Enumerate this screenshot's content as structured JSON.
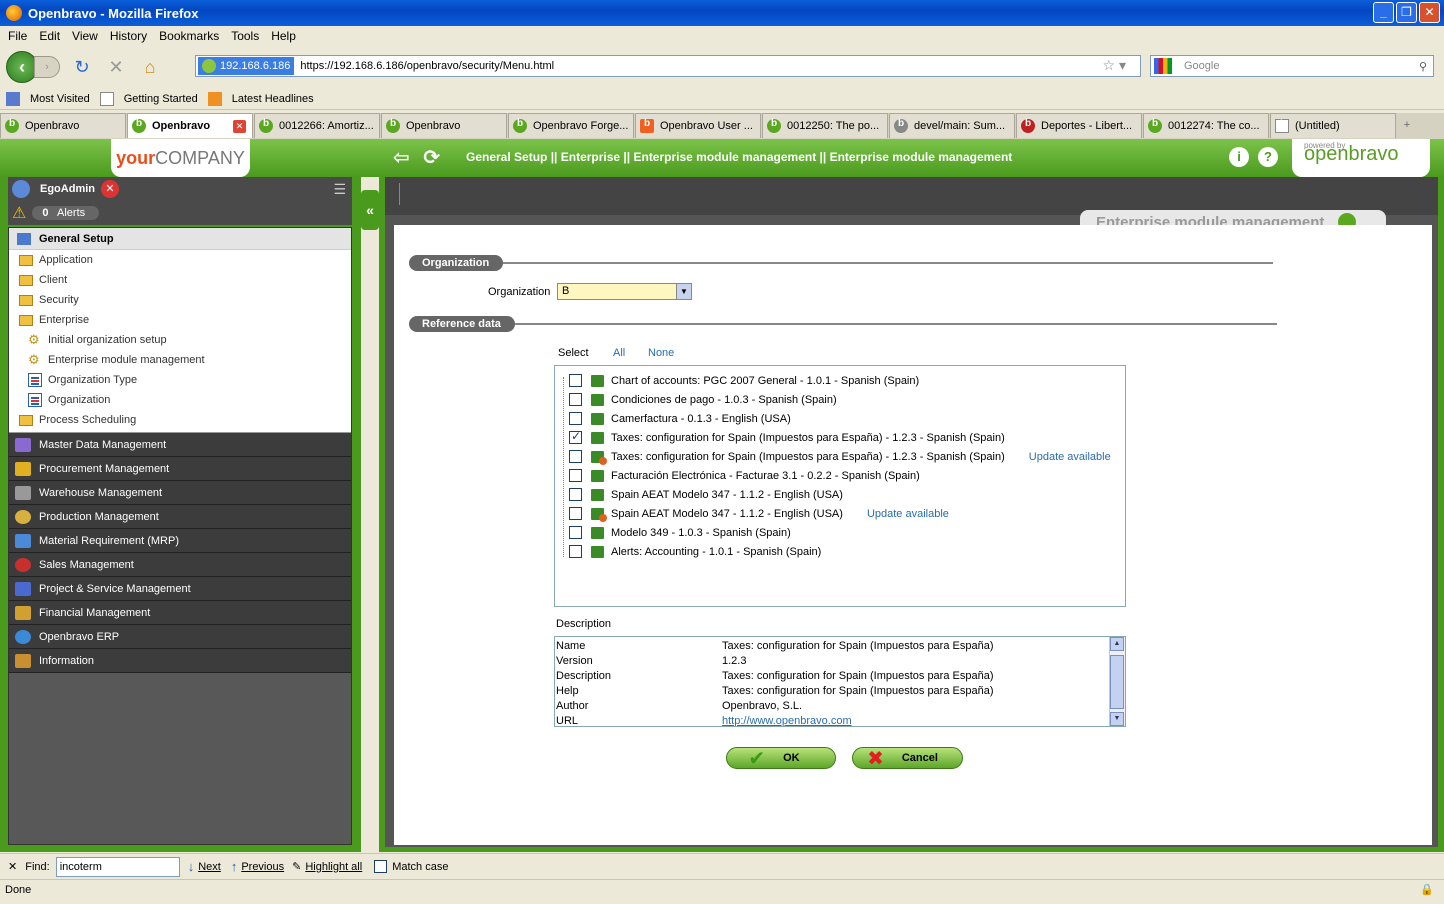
{
  "browser": {
    "title": "Openbravo - Mozilla Firefox",
    "menu": [
      "File",
      "Edit",
      "View",
      "History",
      "Bookmarks",
      "Tools",
      "Help"
    ],
    "url_identity": "192.168.6.186",
    "url": "https://192.168.6.186/openbravo/security/Menu.html",
    "search_placeholder": "Google",
    "bookmarks": [
      "Most Visited",
      "Getting Started",
      "Latest Headlines"
    ],
    "tabs": [
      {
        "label": "Openbravo",
        "active": false
      },
      {
        "label": "Openbravo",
        "active": true
      },
      {
        "label": "0012266: Amortiz...",
        "active": false
      },
      {
        "label": "Openbravo",
        "active": false
      },
      {
        "label": "Openbravo Forge...",
        "active": false
      },
      {
        "label": "Openbravo User ...",
        "active": false
      },
      {
        "label": "0012250: The po...",
        "active": false
      },
      {
        "label": "devel/main: Sum...",
        "active": false
      },
      {
        "label": "Deportes - Libert...",
        "active": false
      },
      {
        "label": "0012274: The co...",
        "active": false
      },
      {
        "label": "(Untitled)",
        "active": false
      }
    ]
  },
  "header": {
    "company_logo_a": "your",
    "company_logo_b": "COMPANY",
    "breadcrumb": "General Setup || Enterprise || Enterprise module management || Enterprise module management",
    "powered_by": "powered by",
    "brand": "openbravo"
  },
  "sidebar": {
    "user": "EgoAdmin",
    "alerts_count": "0",
    "alerts_label": "Alerts",
    "section_title": "General Setup",
    "items": [
      {
        "label": "Application",
        "type": "folder",
        "indent": 0
      },
      {
        "label": "Client",
        "type": "folder",
        "indent": 0
      },
      {
        "label": "Security",
        "type": "folder",
        "indent": 0
      },
      {
        "label": "Enterprise",
        "type": "folder",
        "indent": 0
      },
      {
        "label": "Initial organization setup",
        "type": "process",
        "indent": 1
      },
      {
        "label": "Enterprise module management",
        "type": "process",
        "indent": 1
      },
      {
        "label": "Organization Type",
        "type": "form",
        "indent": 1
      },
      {
        "label": "Organization",
        "type": "form",
        "indent": 1
      },
      {
        "label": "Process Scheduling",
        "type": "folder",
        "indent": 0
      }
    ],
    "sections": [
      {
        "label": "Master Data Management",
        "color": "#8a6ad0"
      },
      {
        "label": "Procurement Management",
        "color": "#e0b020"
      },
      {
        "label": "Warehouse Management",
        "color": "#999999"
      },
      {
        "label": "Production Management",
        "color": "#d8b040"
      },
      {
        "label": "Material Requirement (MRP)",
        "color": "#4a8ad8"
      },
      {
        "label": "Sales Management",
        "color": "#c83030"
      },
      {
        "label": "Project & Service Management",
        "color": "#4a6ad0"
      },
      {
        "label": "Financial Management",
        "color": "#d0a030"
      },
      {
        "label": "Openbravo ERP",
        "color": "#3a8ad8"
      },
      {
        "label": "Information",
        "color": "#c89030"
      }
    ]
  },
  "window": {
    "title": "Enterprise module management",
    "org_section": "Organization",
    "org_label": "Organization",
    "org_value": "B",
    "ref_section": "Reference data",
    "select_label": "Select",
    "select_all": "All",
    "select_none": "None",
    "modules": [
      {
        "label": "Chart of accounts: PGC 2007 General - 1.0.1 - Spanish (Spain)",
        "checked": false,
        "update": ""
      },
      {
        "label": "Condiciones de pago - 1.0.3 - Spanish (Spain)",
        "checked": false,
        "update": ""
      },
      {
        "label": "Camerfactura - 0.1.3 - English (USA)",
        "checked": false,
        "update": ""
      },
      {
        "label": "Taxes: configuration for Spain (Impuestos para España) - 1.2.3 - Spanish (Spain)",
        "checked": true,
        "update": ""
      },
      {
        "label": "Taxes: configuration for Spain (Impuestos para España) - 1.2.3 - Spanish (Spain)",
        "checked": false,
        "update": "Update available"
      },
      {
        "label": "Facturación Electrónica - Facturae 3.1 - 0.2.2 - Spanish (Spain)",
        "checked": false,
        "update": ""
      },
      {
        "label": "Spain AEAT Modelo 347 - 1.1.2 - English (USA)",
        "checked": false,
        "update": ""
      },
      {
        "label": "Spain AEAT Modelo 347 - 1.1.2 - English (USA)",
        "checked": false,
        "update": "Update available"
      },
      {
        "label": "Modelo 349 - 1.0.3 - Spanish (Spain)",
        "checked": false,
        "update": ""
      },
      {
        "label": "Alerts: Accounting - 1.0.1 - Spanish (Spain)",
        "checked": false,
        "update": ""
      }
    ],
    "description_label": "Description",
    "description": [
      {
        "key": "Name",
        "value": "Taxes: configuration for Spain (Impuestos para España)"
      },
      {
        "key": "Version",
        "value": "1.2.3"
      },
      {
        "key": "Description",
        "value": "Taxes: configuration for Spain (Impuestos para España)"
      },
      {
        "key": "Help",
        "value": "Taxes: configuration for Spain (Impuestos para España)"
      },
      {
        "key": "Author",
        "value": "Openbravo, S.L."
      },
      {
        "key": "URL",
        "value": "http://www.openbravo.com"
      }
    ],
    "ok_label": "OK",
    "cancel_label": "Cancel"
  },
  "findbar": {
    "label": "Find:",
    "value": "incoterm",
    "next": "Next",
    "previous": "Previous",
    "highlight": "Highlight all",
    "matchcase": "Match case"
  },
  "status": "Done"
}
